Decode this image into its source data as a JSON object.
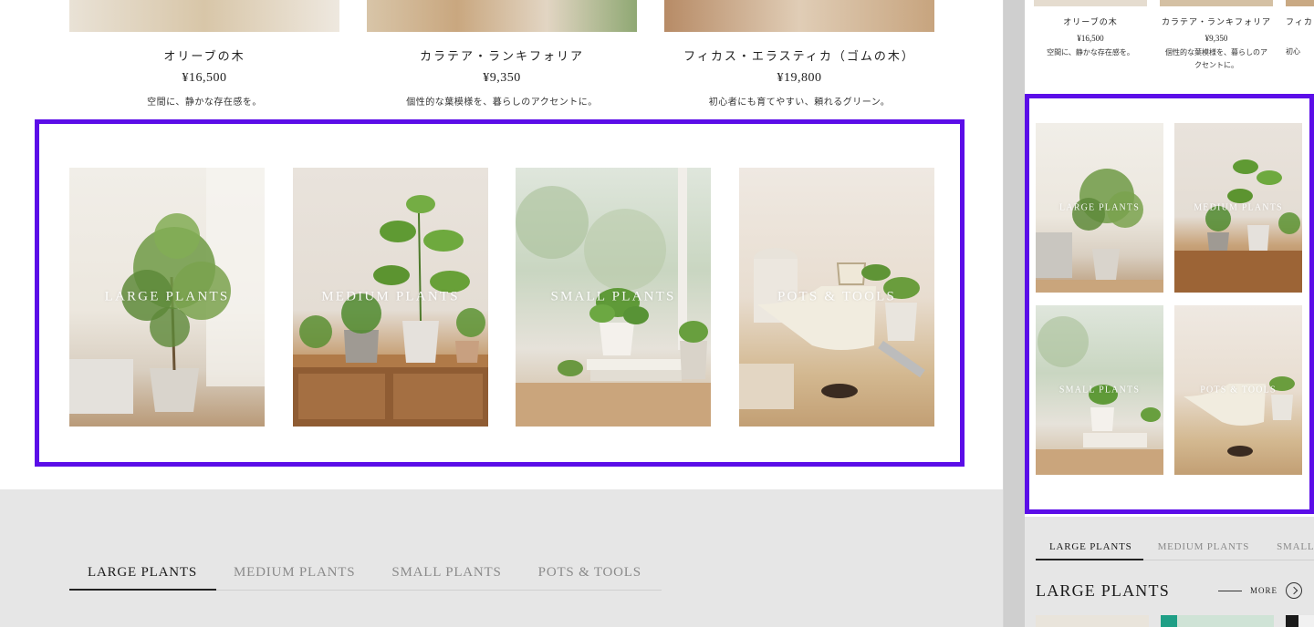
{
  "desktop": {
    "products": [
      {
        "name": "オリーブの木",
        "price": "¥16,500",
        "desc": "空間に、静かな存在感を。"
      },
      {
        "name": "カラテア・ランキフォリア",
        "price": "¥9,350",
        "desc": "個性的な葉模様を、暮らしのアクセントに。"
      },
      {
        "name": "フィカス・エラスティカ（ゴムの木）",
        "price": "¥19,800",
        "desc": "初心者にも育てやすい、頼れるグリーン。"
      }
    ],
    "categories": [
      {
        "label": "LARGE PLANTS"
      },
      {
        "label": "MEDIUM PLANTS"
      },
      {
        "label": "SMALL PLANTS"
      },
      {
        "label": "POTS & TOOLS"
      }
    ],
    "tabs": [
      "LARGE PLANTS",
      "MEDIUM PLANTS",
      "SMALL PLANTS",
      "POTS & TOOLS"
    ]
  },
  "mobile": {
    "products": [
      {
        "name": "オリーブの木",
        "price": "¥16,500",
        "desc": "空間に、静かな存在感を。"
      },
      {
        "name": "カラテア・ランキフォリア",
        "price": "¥9,350",
        "desc": "個性的な葉模様を、暮らしのアクセントに。"
      },
      {
        "name": "フィカ",
        "price": "",
        "desc": "初心"
      }
    ],
    "categories": [
      {
        "label": "LARGE PLANTS"
      },
      {
        "label": "MEDIUM PLANTS"
      },
      {
        "label": "SMALL PLANTS"
      },
      {
        "label": "POTS & TOOLS"
      }
    ],
    "tabs": [
      "LARGE PLANTS",
      "MEDIUM PLANTS",
      "SMALL"
    ],
    "section_title": "LARGE PLANTS",
    "more_label": "MORE"
  },
  "colors": {
    "highlight": "#5b0de8",
    "gray_band": "#e6e6e6",
    "text": "#222222",
    "muted_tab": "#8a8a8a"
  },
  "icons": {
    "more": "chevron-right-circle-icon"
  }
}
